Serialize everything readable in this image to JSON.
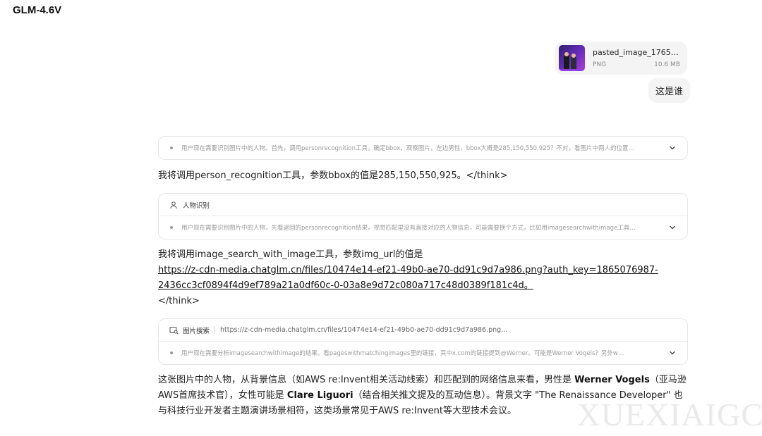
{
  "app": {
    "title": "GLM-4.6V"
  },
  "user_message": {
    "attachment": {
      "name": "pasted_image_17650...",
      "type": "PNG",
      "size": "10.6 MB",
      "thumb_icon": "image-thumbnail"
    },
    "text": "这是谁"
  },
  "assistant": {
    "think1": {
      "text": "用户现在需要识别图片中的人物。首先，调用personrecognition工具，确定bbox，观察图片，左边男性，bbox大概是285,150,550,925？不对，看图片中两人的位置…"
    },
    "line1": "我将调用person_recognition工具，参数bbox的值是285,150,550,925。</think>",
    "tool1": {
      "icon": "user-icon",
      "label": "人物识别",
      "think": "用户现在需要识别图片中的人物，先看返回的personrecognition结果，视觉匹配里没有直接对应的人物信息，可能需要换个方式，比如用imagesearchwithimage工具…"
    },
    "line2": {
      "prefix": "我将调用image_search_with_image工具，参数img_url的值是",
      "url_part1": "https://z-cdn-media.chatglm.cn/files/10474e14-ef21-49b0-ae70-dd91c9d7a986.png?auth_key=1865076987-",
      "url_part2": "2436cc3cf0894f4d9ef789a21a0df60c-0-03a8e9d72c080a717c48d0389f181c4d。",
      "suffix": "</think>"
    },
    "tool2": {
      "icon": "image-search-icon",
      "label": "图片搜索",
      "url": "https://z-cdn-media.chatglm.cn/files/10474e14-ef21-49b0-ae70-dd91c9d7a986.png...",
      "think": "用户现在需要分析imagesearchwithimage的结果。看pageswithmatchingimages里的链接，其中x.com的链接提到@Werner。可能是Werner Vogels？另外w…"
    },
    "answer": {
      "t1": "这张图片中的人物，从背景信息（如AWS re:Invent相关活动线索）和匹配到的网络信息来看，男性是 ",
      "name1": "Werner Vogels",
      "t2": "（亚马逊AWS首席技术官），女性可能是 ",
      "name2": "Clare Liguori",
      "t3": "（结合相关推文提及的互动信息）。背景文字 \"The Renaissance Developer\" 也与科技行业开发者主题演讲场景相符，这类场景常见于AWS re:Invent等大型技术会议。"
    }
  },
  "watermark": "XUEXIAIGC",
  "colors": {
    "border": "#e6e6e6",
    "bubble": "#f4f4f5",
    "muted": "#9a9a9a",
    "text": "#222222"
  }
}
